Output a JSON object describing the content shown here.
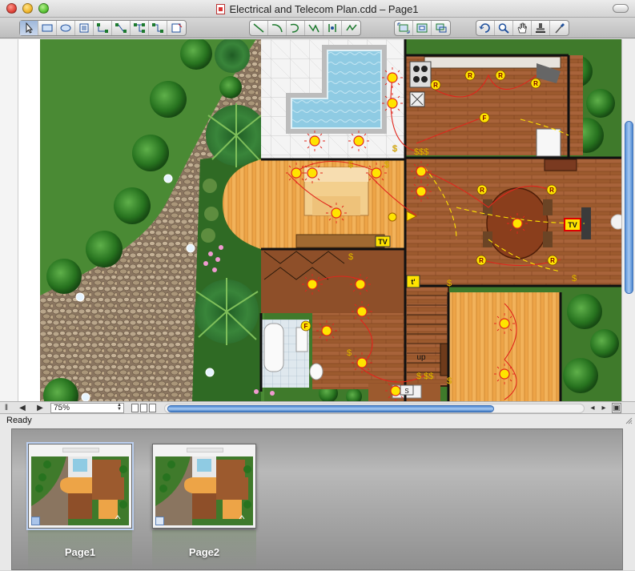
{
  "window": {
    "title": "Electrical and Telecom Plan.cdd – Page1"
  },
  "toolbar": {
    "groups": [
      [
        "pointer-tool",
        "rectangle-tool",
        "ellipse-tool",
        "text-tool",
        "connector-tool",
        "smart-connector-tool",
        "tree-connector-tool",
        "chain-tool",
        "insert-tool"
      ],
      [
        "line-tool",
        "arc-tool",
        "curve-tool",
        "polyline-tool",
        "bezier-tool",
        "freehand-tool"
      ],
      [
        "zoom-fit-tool",
        "zoom-page-tool",
        "zoom-selection-tool"
      ],
      [
        "rotate-tool",
        "zoom-tool",
        "pan-hand-tool",
        "stamp-tool",
        "eyedropper-tool"
      ]
    ]
  },
  "canvas": {
    "labels": {
      "tv1": "TV",
      "tv2": "TV",
      "tp": "t'",
      "up": "up",
      "s": "S",
      "dollars1": "$$$",
      "dollars2": "$ $$",
      "dollar1": "$",
      "dollar2": "$",
      "dollar3": "$",
      "dollar4": "$",
      "dollar5": "$",
      "dollar6": "$",
      "dollar7": "$",
      "dollar8": "$",
      "r": "R",
      "f": "F"
    },
    "colors": {
      "grass": "#3f7a2b",
      "wood": "#9c5a2e",
      "light_wood": "#e8a343",
      "pool": "#8fcbe3",
      "fixture": "#ffe400",
      "wiring": "#e1261c"
    }
  },
  "bottombar": {
    "zoom": "75%"
  },
  "status": {
    "text": "Ready"
  },
  "pages": [
    {
      "label": "Page1",
      "selected": true
    },
    {
      "label": "Page2",
      "selected": false
    }
  ]
}
